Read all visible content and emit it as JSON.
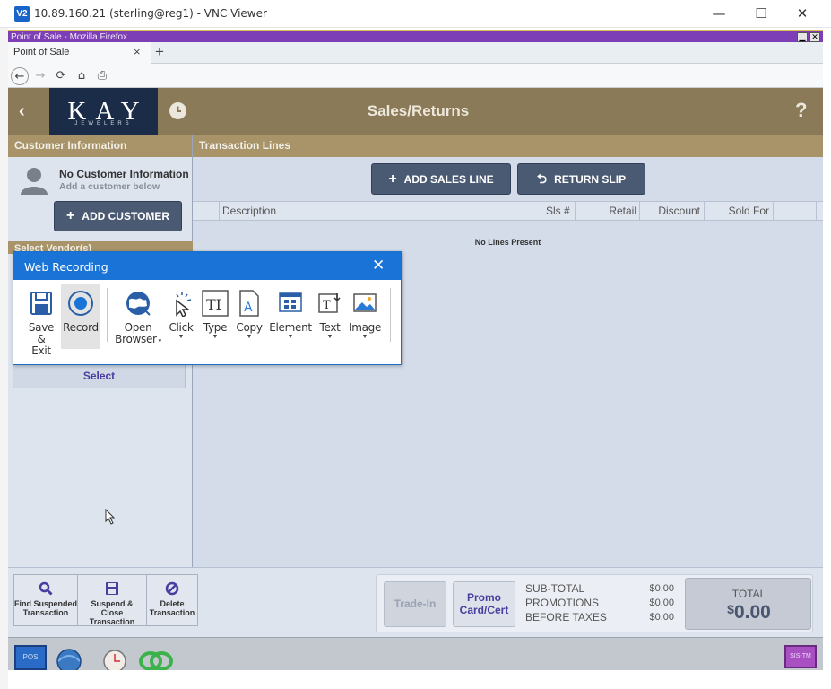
{
  "vnc": {
    "title": "10.89.160.21 (sterling@reg1) - VNC Viewer",
    "logo": "V2",
    "min": "—",
    "max": "☐",
    "close": "✕"
  },
  "firefox": {
    "title": "Point of Sale - Mozilla Firefox",
    "tab_label": "Point of Sale",
    "tab_close": "×",
    "new_tab": "+",
    "win_min": "▁",
    "win_close": "✕"
  },
  "pos": {
    "back": "‹",
    "logo_main": "KAY",
    "logo_sub": "JEWELERS",
    "page_title": "Sales/Returns",
    "help": "?",
    "customer": {
      "header": "Customer Information",
      "none_title": "No Customer Information",
      "none_sub": "Add a customer below",
      "add_button": "ADD CUSTOMER",
      "select_header": "Select Vendor(s)",
      "select_button": "Select"
    },
    "transaction": {
      "header": "Transaction Lines",
      "add_sales_line": "ADD SALES LINE",
      "return_slip": "RETURN SLIP",
      "columns": [
        "Description",
        "Sls #",
        "Retail",
        "Discount",
        "Sold For"
      ],
      "empty": "No Lines Present"
    },
    "bottom": {
      "buttons": [
        {
          "label1": "Find Suspended",
          "label2": "Transaction"
        },
        {
          "label1": "Suspend &",
          "label2": "Close Transaction"
        },
        {
          "label1": "Delete",
          "label2": "Transaction"
        }
      ],
      "trade_in": "Trade-In",
      "promo1": "Promo",
      "promo2": "Card/Cert",
      "subtotal_label": "SUB-TOTAL",
      "promotions_label": "PROMOTIONS",
      "before_taxes_label": "BEFORE TAXES",
      "subtotal_value": "$0.00",
      "promotions_value": "$0.00",
      "before_taxes_value": "$0.00",
      "total_label": "TOTAL",
      "total_currency": "$",
      "total_value": "0.00"
    },
    "taskbar": {
      "pos_label": "POS",
      "right_label": "SIS-TM"
    }
  },
  "web_recording": {
    "title": "Web Recording",
    "close": "✕",
    "tools": [
      {
        "label": "Save\n& Exit",
        "icon": "floppy-disk-icon"
      },
      {
        "label": "Record",
        "icon": "record-icon"
      },
      {
        "label": "Open\nBrowser",
        "icon": "globe-icon"
      },
      {
        "label": "Click",
        "icon": "click-pointer-icon"
      },
      {
        "label": "Type",
        "icon": "type-text-icon"
      },
      {
        "label": "Copy",
        "icon": "copy-document-icon"
      },
      {
        "label": "Element",
        "icon": "element-grid-icon"
      },
      {
        "label": "Text",
        "icon": "text-extract-icon"
      },
      {
        "label": "Image",
        "icon": "image-icon"
      }
    ],
    "labels": {
      "save1": "Save",
      "save2": "& Exit",
      "record": "Record",
      "open1": "Open",
      "open2": "Browser",
      "click": "Click",
      "type": "Type",
      "copy": "Copy",
      "element": "Element",
      "text": "Text",
      "image": "Image"
    }
  },
  "colors": {
    "header_bg": "#8a7a58",
    "section_bg": "#a89468",
    "navy_button": "#4b5a73",
    "dialog_blue": "#1a73d6",
    "firefox_title": "#7d3fb6"
  }
}
